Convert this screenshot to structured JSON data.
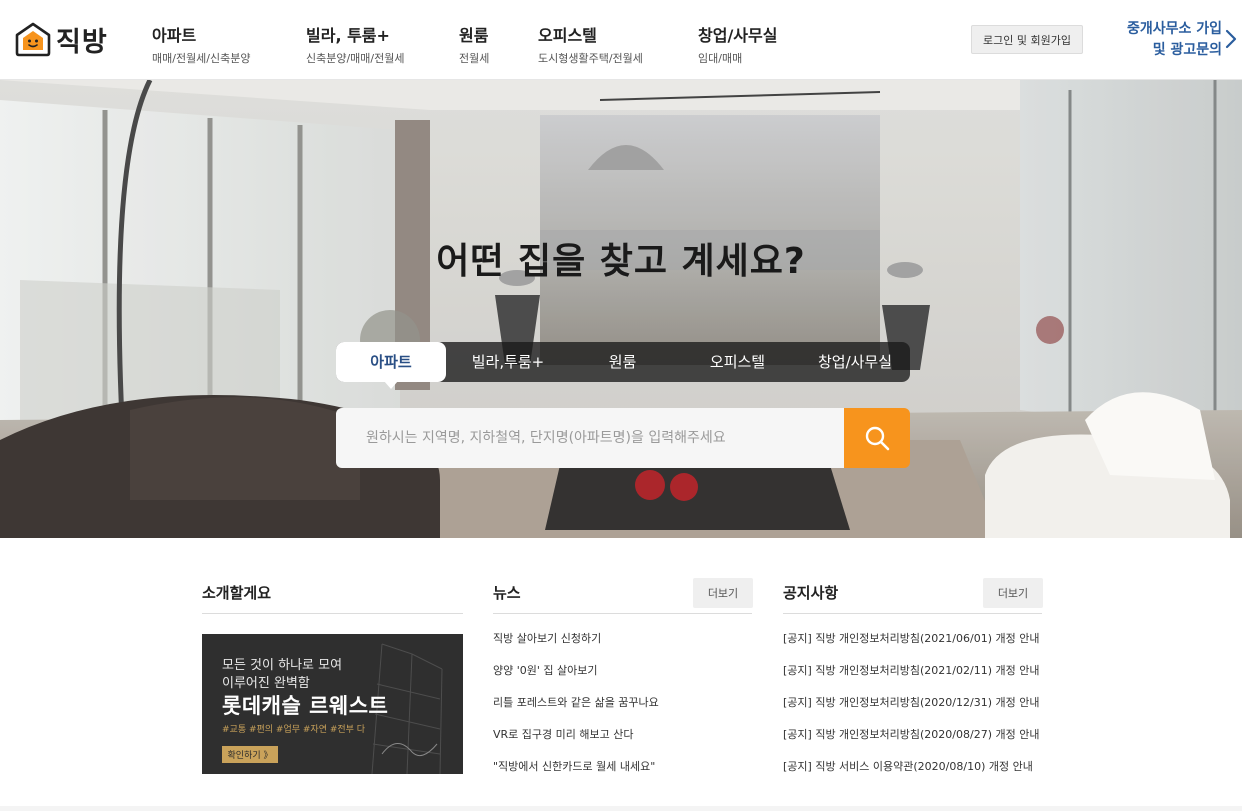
{
  "header": {
    "logo_text": "직방",
    "nav": [
      {
        "title": "아파트",
        "sub": "매매/전월세/신축분양"
      },
      {
        "title": "빌라, 투룸+",
        "sub": "신축분양/매매/전월세"
      },
      {
        "title": "원룸",
        "sub": "전월세"
      },
      {
        "title": "오피스텔",
        "sub": "도시형생활주택/전월세"
      },
      {
        "title": "창업/사무실",
        "sub": "임대/매매"
      }
    ],
    "login_label": "로그인 및 회원가입",
    "broker_line1": "중개사무소 가입",
    "broker_line2": "및 광고문의"
  },
  "hero": {
    "title": "어떤 집을 찾고 계세요?",
    "tabs": [
      "아파트",
      "빌라,투룸+",
      "원룸",
      "오피스텔",
      "창업/사무실"
    ],
    "active_tab": "아파트",
    "search_placeholder": "원하시는 지역명, 지하철역, 단지명(아파트명)을 입력해주세요"
  },
  "intro": {
    "title": "소개할게요",
    "banner": {
      "line1": "모든 것이 하나로 모여",
      "line2": "이루어진 완벽함",
      "headline": "롯데캐슬 르웨스트",
      "tags": "#교통 #편의 #업무 #자연 #전부 다",
      "cta": "확인하기 》"
    }
  },
  "news": {
    "title": "뉴스",
    "more_label": "더보기",
    "items": [
      "직방 살아보기 신청하기",
      "양양 '0원' 집 살아보기",
      "리틀 포레스트와 같은 삶을 꿈꾸나요",
      "VR로 집구경 미리 해보고 산다",
      "\"직방에서 신한카드로 월세 내세요\""
    ]
  },
  "notice": {
    "title": "공지사항",
    "more_label": "더보기",
    "items": [
      "[공지] 직방 개인정보처리방침(2021/06/01) 개정 안내",
      "[공지] 직방 개인정보처리방침(2021/02/11) 개정 안내",
      "[공지] 직방 개인정보처리방침(2020/12/31) 개정 안내",
      "[공지] 직방 개인정보처리방침(2020/08/27) 개정 안내",
      "[공지] 직방 서비스 이용약관(2020/08/10) 개정 안내"
    ]
  },
  "colors": {
    "accent_orange": "#f7941d",
    "brand_blue": "#2a5d9e",
    "active_tab_text": "#2a4f85"
  },
  "icons": {
    "logo": "house-face-icon",
    "search": "search-icon",
    "broker": "chevron-right-icon"
  }
}
